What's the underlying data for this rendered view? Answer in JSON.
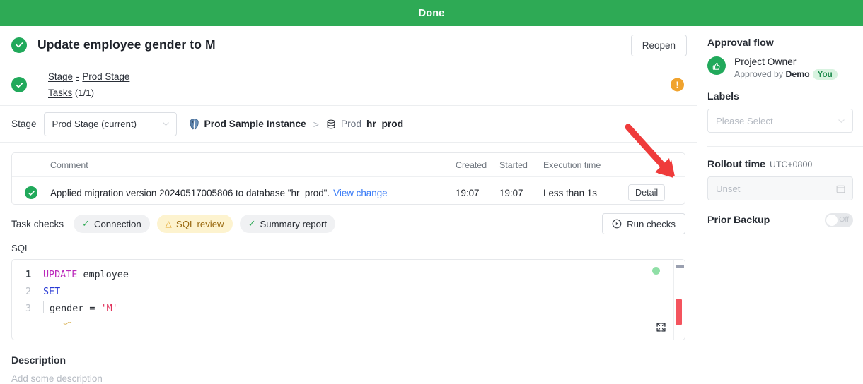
{
  "status_bar": {
    "label": "Done"
  },
  "header": {
    "title": "Update employee gender to M",
    "reopen_label": "Reopen",
    "status_icon": "check-circle-icon"
  },
  "stage_summary": {
    "stage_link": "Stage",
    "dash": "-",
    "stage_name": "Prod Stage",
    "tasks_label": "Tasks",
    "tasks_count": "(1/1)",
    "warning_icon": "exclamation-circle-icon"
  },
  "stage_selector": {
    "label": "Stage",
    "selected": "Prod Stage (current)",
    "chevron_icon": "chevron-down-icon",
    "breadcrumb": {
      "instance_icon": "postgres-elephant-icon",
      "instance": "Prod Sample Instance",
      "separator": ">",
      "db_icon": "database-icon",
      "env": "Prod",
      "database": "hr_prod"
    }
  },
  "task_table": {
    "columns": [
      "",
      "Comment",
      "Created",
      "Started",
      "Execution time",
      ""
    ],
    "rows": [
      {
        "status_icon": "check-circle-icon",
        "comment": "Applied migration version 20240517005806 to database \"hr_prod\".",
        "view_change": "View change",
        "created": "19:07",
        "started": "19:07",
        "execution_time": "Less than 1s",
        "action": "Detail"
      }
    ]
  },
  "task_checks": {
    "title": "Task checks",
    "chips": [
      {
        "label": "Connection",
        "state": "ok",
        "icon": "check-icon"
      },
      {
        "label": "SQL review",
        "state": "warn",
        "icon": "warning-triangle-icon"
      },
      {
        "label": "Summary report",
        "state": "ok",
        "icon": "check-icon"
      }
    ],
    "run_checks_label": "Run checks",
    "run_checks_icon": "play-circle-icon"
  },
  "sql": {
    "label": "SQL",
    "lines": [
      {
        "num": "1",
        "tokens": [
          {
            "t": "UPDATE",
            "c": "kw-update"
          },
          {
            "t": " ",
            "c": "op"
          },
          {
            "t": "employee",
            "c": "ident"
          }
        ]
      },
      {
        "num": "2",
        "tokens": [
          {
            "t": "SET",
            "c": "kw-set"
          }
        ]
      },
      {
        "num": "3",
        "tokens": [
          {
            "t": "gender",
            "c": "ident"
          },
          {
            "t": " = ",
            "c": "op"
          },
          {
            "t": "'M'",
            "c": "str"
          }
        ]
      }
    ],
    "expand_icon": "fullscreen-expand-icon"
  },
  "description": {
    "title": "Description",
    "placeholder": "Add some description"
  },
  "sidebar": {
    "approval_flow_title": "Approval flow",
    "approver": {
      "icon": "thumbs-up-icon",
      "role": "Project Owner",
      "approved_prefix": "Approved by",
      "approved_by": "Demo",
      "you_badge": "You"
    },
    "labels_title": "Labels",
    "labels_placeholder": "Please Select",
    "labels_chevron_icon": "chevron-down-icon",
    "rollout_title": "Rollout time",
    "rollout_tz": "UTC+0800",
    "rollout_placeholder": "Unset",
    "rollout_icon": "calendar-icon",
    "prior_backup_title": "Prior Backup",
    "prior_backup_state": "Off"
  },
  "annotation": {
    "arrow_icon": "red-arrow-icon",
    "color": "#ef3b3b"
  },
  "colors": {
    "green": "#2eaa55",
    "warn": "#f0a32e",
    "link": "#3478f6",
    "accent_red": "#ef3b3b"
  }
}
